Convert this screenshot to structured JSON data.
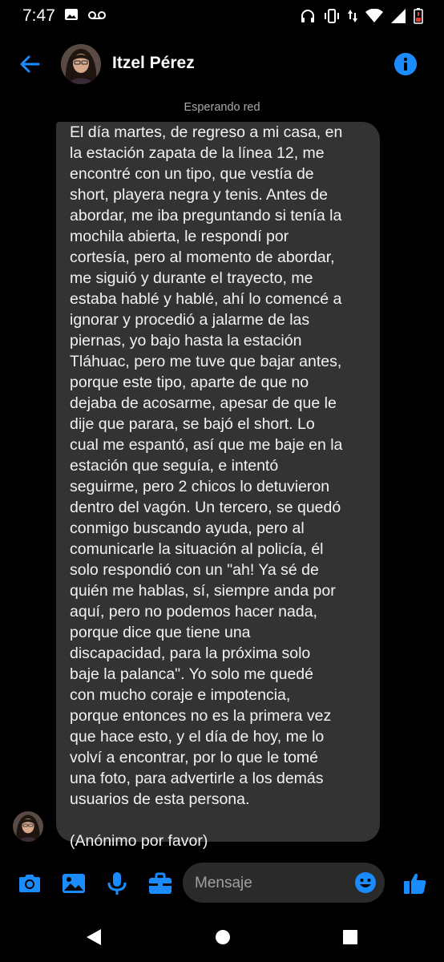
{
  "status_bar": {
    "time": "7:47"
  },
  "header": {
    "contact_name": "Itzel Pérez"
  },
  "network_status": "Esperando red",
  "message": {
    "text": "El día martes, de regreso a mi casa, en\nla estación zapata de la línea 12, me\nencontré con un tipo, que vestía de\nshort, playera negra y tenis. Antes de\nabordar, me iba preguntando si tenía la\nmochila abierta, le respondí por\ncortesía, pero al momento de abordar,\nme siguió y durante el trayecto, me\nestaba hablé y hablé, ahí lo comencé a\nignorar y procedió a jalarme de las\npiernas, yo bajo hasta la estación\nTláhuac, pero me tuve que bajar antes,\nporque este tipo, aparte de que no\ndejaba de acosarme, apesar de que le\ndije que parara, se bajó el short. Lo\ncual me espantó, así que me baje en la\nestación que seguía, e intentó\nseguirme, pero 2 chicos lo detuvieron\ndentro del vagón. Un tercero, se quedó\nconmigo buscando ayuda, pero al\ncomunicarle la situación al policía, él\nsolo respondió con un \"ah! Ya sé de\nquién me hablas, sí, siempre anda por\naquí, pero no podemos hacer nada,\nporque dice que tiene una\ndiscapacidad, para la próxima solo\nbaje la palanca\". Yo solo me quedé\ncon mucho coraje e impotencia,\nporque entonces no es la primera vez\nque hace esto, y el día de hoy, me lo\nvolví a encontrar, por lo que le tomé\nuna foto, para advertirle a los demás\nusuarios de esta persona.\n\n(Anónimo por favor)"
  },
  "composer": {
    "placeholder": "Mensaje"
  },
  "colors": {
    "accent": "#1a8cff",
    "bubble": "#333333",
    "background": "#000000"
  },
  "icons": [
    "image-icon",
    "voicemail-icon",
    "headphones-icon",
    "vibrate-icon",
    "data-arrows-icon",
    "wifi-icon",
    "signal-icon",
    "battery-icon",
    "back-arrow-icon",
    "info-icon",
    "camera-icon",
    "gallery-icon",
    "microphone-icon",
    "briefcase-icon",
    "emoji-icon",
    "thumbs-up-icon",
    "nav-back-icon",
    "nav-home-icon",
    "nav-recents-icon"
  ]
}
